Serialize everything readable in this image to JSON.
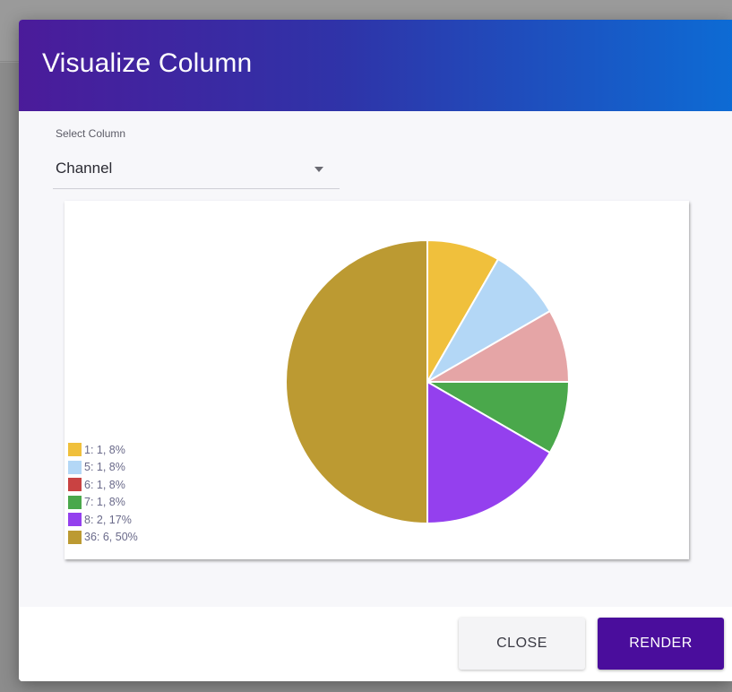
{
  "dialog": {
    "title": "Visualize Column",
    "select_label": "Select Column",
    "selected_column": "Channel",
    "buttons": {
      "close": "CLOSE",
      "render": "RENDER"
    }
  },
  "chart_data": {
    "type": "pie",
    "title": "",
    "legend_position": "bottom-left",
    "slices": [
      {
        "label": "1: 1, 8%",
        "value": 1,
        "percent": 8,
        "color": "#f0c03c"
      },
      {
        "label": "5: 1, 8%",
        "value": 1,
        "percent": 8,
        "color": "#b3d7f6"
      },
      {
        "label": "6: 1, 8%",
        "value": 1,
        "percent": 8,
        "color": "#e5a5a6",
        "legend_color": "#c94242"
      },
      {
        "label": "7: 1, 8%",
        "value": 1,
        "percent": 8,
        "color": "#4aa84b"
      },
      {
        "label": "8: 2, 17%",
        "value": 2,
        "percent": 17,
        "color": "#9440ee"
      },
      {
        "label": "36: 6, 50%",
        "value": 6,
        "percent": 50,
        "color": "#bc9a32"
      }
    ]
  }
}
